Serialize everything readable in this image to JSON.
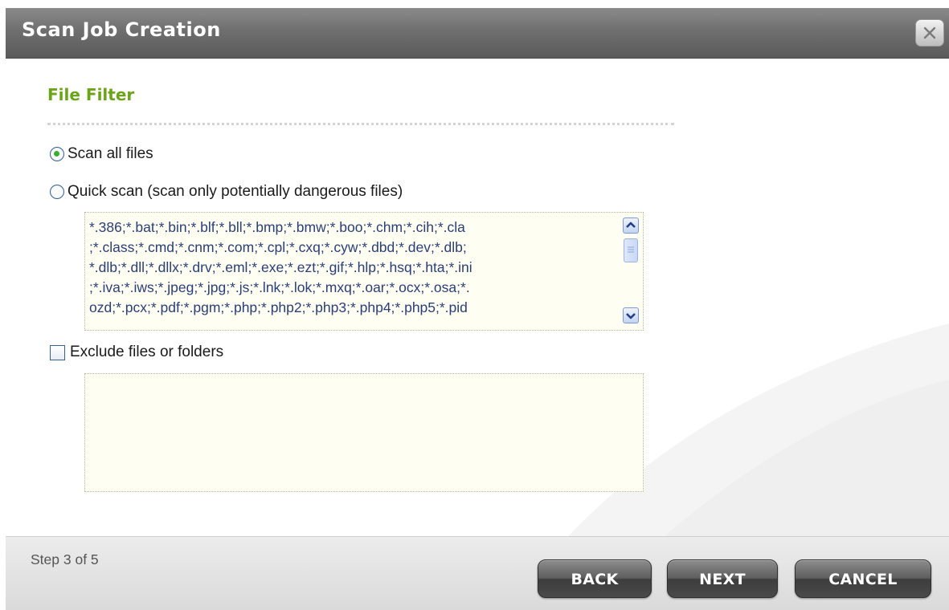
{
  "dialog": {
    "title": "Scan Job Creation"
  },
  "section": {
    "title": "File Filter"
  },
  "options": {
    "scan_all": {
      "label": "Scan all files",
      "checked": true
    },
    "quick_scan": {
      "label": "Quick scan (scan only potentially dangerous files)",
      "checked": false,
      "extensions_lines": [
        "*.386;*.bat;*.bin;*.blf;*.bll;*.bmp;*.bmw;*.boo;*.chm;*.cih;*.cla",
        ";*.class;*.cmd;*.cnm;*.com;*.cpl;*.cxq;*.cyw;*.dbd;*.dev;*.dlb;",
        "*.dlb;*.dll;*.dllx;*.drv;*.eml;*.exe;*.ezt;*.gif;*.hlp;*.hsq;*.hta;*.ini",
        ";*.iva;*.iws;*.jpeg;*.jpg;*.js;*.lnk;*.lok;*.mxq;*.oar;*.ocx;*.osa;*.",
        "ozd;*.pcx;*.pdf;*.pgm;*.php;*.php2;*.php3;*.php4;*.php5;*.pid"
      ]
    },
    "exclude": {
      "label": "Exclude files or folders",
      "checked": false,
      "value": ""
    }
  },
  "footer": {
    "step": "Step 3 of 5",
    "back_label": "BACK",
    "next_label": "NEXT",
    "cancel_label": "CANCEL"
  },
  "colors": {
    "section_title": "#6aa518",
    "titlebar": "#6f6f6f",
    "extension_text": "#2a3f7a",
    "textarea_bg": "#fefef2"
  }
}
